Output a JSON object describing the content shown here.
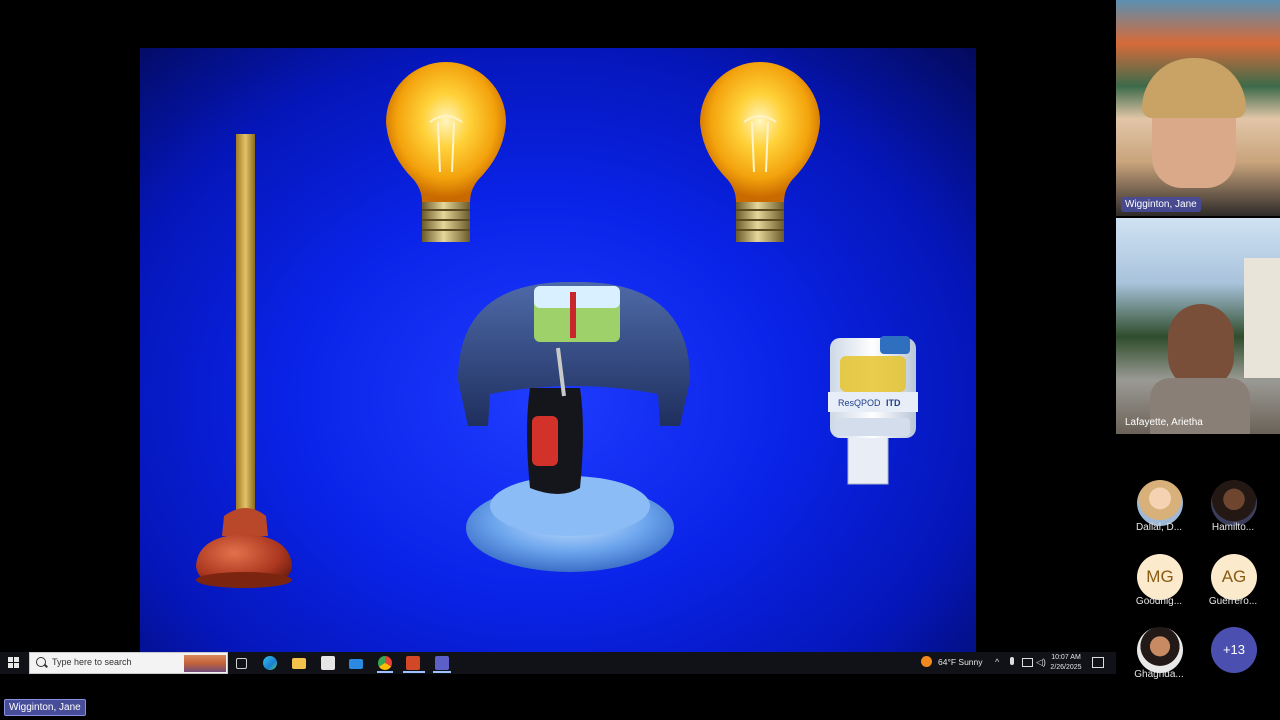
{
  "slide": {
    "items": [
      "plunger",
      "light-bulb",
      "light-bulb",
      "cpr-device",
      "itd-valve"
    ],
    "itd_label": "ResQPOD",
    "itd_suffix": "ITD"
  },
  "taskbar": {
    "search_placeholder": "Type here to search",
    "apps": [
      "task-view",
      "edge",
      "file-explorer",
      "store",
      "mail",
      "chrome",
      "powerpoint",
      "teams"
    ],
    "weather": "64°F  Sunny",
    "time": "10:07 AM",
    "date": "2/26/2025"
  },
  "participants": {
    "video": [
      {
        "name": "Wigginton, Jane"
      },
      {
        "name": "Lafayette, Arietha"
      }
    ],
    "avatars": [
      {
        "name": "Dallal, D...",
        "initials": ""
      },
      {
        "name": "Hamilto...",
        "initials": ""
      },
      {
        "name": "Goodnig...",
        "initials": "MG"
      },
      {
        "name": "Guerrero...",
        "initials": "AG"
      },
      {
        "name": "Ghaghda...",
        "initials": ""
      },
      {
        "name": "",
        "initials": "+13"
      }
    ]
  },
  "presenter": {
    "name": "Wigginton, Jane"
  },
  "colors": {
    "accent": "#4b50b0",
    "slide_blue": "#0a23e8"
  }
}
